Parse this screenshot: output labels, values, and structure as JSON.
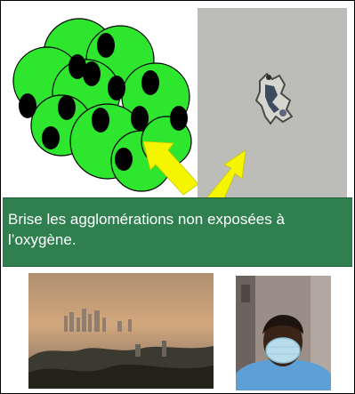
{
  "caption": {
    "text": "Brise les agglomérations non exposées à l’oxygène."
  },
  "colors": {
    "caption_background": "#2f7f4f",
    "sphere_green": "#2ee62e",
    "black_dot": "#000000",
    "arrow_yellow": "#f5f500",
    "photo_background": "#b8b8b4"
  },
  "illustrations": {
    "top_left": "agglomeration-diagram",
    "top_right": "particle-photo",
    "bottom_left": "smog-city-photo",
    "bottom_right": "child-with-mask-photo"
  }
}
